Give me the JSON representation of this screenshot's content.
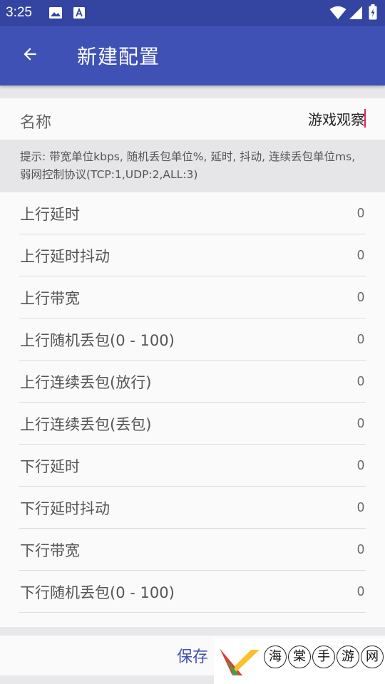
{
  "status_bar": {
    "time": "3:25",
    "icons": [
      "image-icon",
      "a-notification-icon",
      "wifi-icon",
      "signal-icon",
      "battery-icon"
    ]
  },
  "app_bar": {
    "back_icon": "arrow-left-icon",
    "title": "新建配置"
  },
  "name_field": {
    "label": "名称",
    "value": "游戏观察"
  },
  "hint": "提示: 带宽单位kbps, 随机丢包单位%, 延时, 抖动, 连续丢包单位ms, 弱网控制协议(TCP:1,UDP:2,ALL:3)",
  "settings": [
    {
      "label": "上行延时",
      "value": "0"
    },
    {
      "label": "上行延时抖动",
      "value": "0"
    },
    {
      "label": "上行带宽",
      "value": "0"
    },
    {
      "label": "上行随机丢包(0 - 100)",
      "value": "0"
    },
    {
      "label": "上行连续丢包(放行)",
      "value": "0"
    },
    {
      "label": "上行连续丢包(丢包)",
      "value": "0"
    },
    {
      "label": "下行延时",
      "value": "0"
    },
    {
      "label": "下行延时抖动",
      "value": "0"
    },
    {
      "label": "下行带宽",
      "value": "0"
    },
    {
      "label": "下行随机丢包(0 - 100)",
      "value": "0"
    }
  ],
  "actions": {
    "save_label": "保存"
  },
  "watermark": {
    "chars": [
      "海",
      "棠",
      "手",
      "游",
      "网"
    ]
  },
  "colors": {
    "primary": "#3f51b5",
    "status_bar": "#3345a1",
    "accent": "#e91e63"
  }
}
